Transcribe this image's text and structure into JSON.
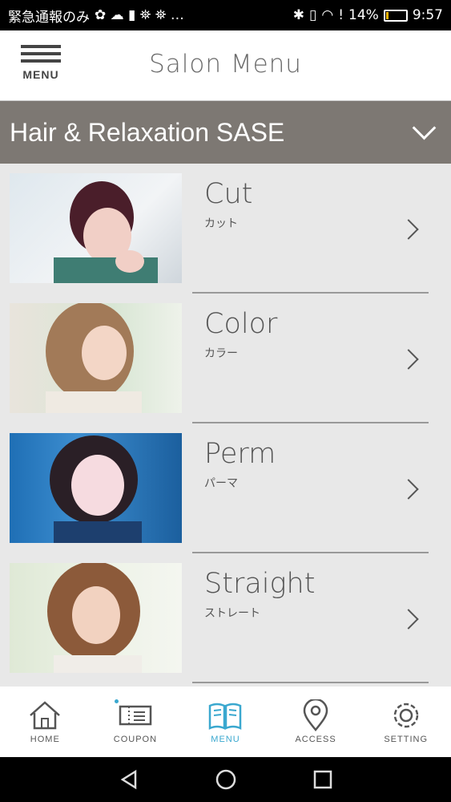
{
  "statusbar": {
    "left_text": "緊急通報のみ",
    "left_icons": "✿ ☁ ▮ ⛯ ⛯ …",
    "battery": "14%",
    "battery_level": 0.14,
    "time": "9:57"
  },
  "header": {
    "menu_label": "MENU",
    "title": "Salon Menu"
  },
  "salon": {
    "name": "Hair & Relaxation SASE"
  },
  "menu_items": [
    {
      "title": "Cut",
      "subtitle": "カット"
    },
    {
      "title": "Color",
      "subtitle": "カラー"
    },
    {
      "title": "Perm",
      "subtitle": "パーマ"
    },
    {
      "title": "Straight",
      "subtitle": "ストレート"
    }
  ],
  "tabs": [
    {
      "label": "HOME",
      "icon": "home-icon"
    },
    {
      "label": "COUPON",
      "icon": "coupon-icon"
    },
    {
      "label": "MENU",
      "icon": "book-icon"
    },
    {
      "label": "ACCESS",
      "icon": "map-pin-icon"
    },
    {
      "label": "SETTING",
      "icon": "gear-icon"
    }
  ],
  "colors": {
    "salon_bar": "#7d7873",
    "active_tab": "#3aa8cf"
  }
}
